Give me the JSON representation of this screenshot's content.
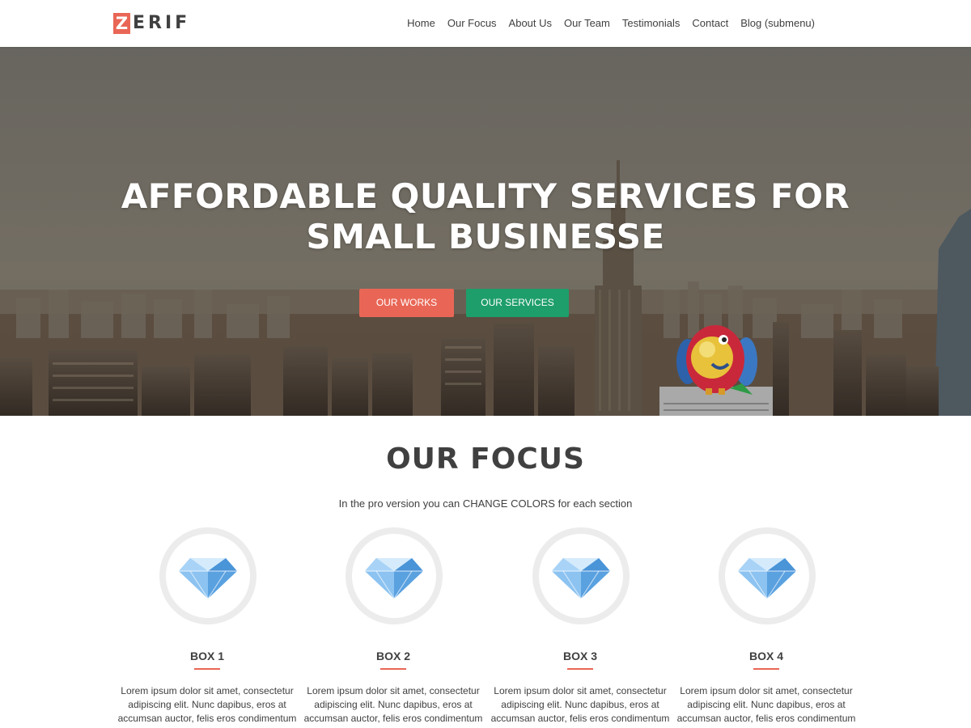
{
  "header": {
    "logo_letter": "Z",
    "logo_rest": "ERIF",
    "nav": [
      "Home",
      "Our Focus",
      "About Us",
      "Our Team",
      "Testimonials",
      "Contact",
      "Blog (submenu)"
    ]
  },
  "hero": {
    "title_line1": "AFFORDABLE QUALITY SERVICES FOR",
    "title_line2": "SMALL BUSINESSE",
    "btn_works": "OUR WORKS",
    "btn_services": "OUR SERVICES"
  },
  "focus": {
    "title": "OUR FOCUS",
    "subtitle": "In the pro version you can CHANGE COLORS for each section",
    "boxes": [
      {
        "title": "BOX 1",
        "icon": "diamond-icon",
        "text": "Lorem ipsum dolor sit amet, consectetur adipiscing elit. Nunc dapibus, eros at accumsan auctor, felis eros condimentum"
      },
      {
        "title": "BOX 2",
        "icon": "diamond-icon",
        "text": "Lorem ipsum dolor sit amet, consectetur adipiscing elit. Nunc dapibus, eros at accumsan auctor, felis eros condimentum"
      },
      {
        "title": "BOX 3",
        "icon": "diamond-icon",
        "text": "Lorem ipsum dolor sit amet, consectetur adipiscing elit. Nunc dapibus, eros at accumsan auctor, felis eros condimentum"
      },
      {
        "title": "BOX 4",
        "icon": "diamond-icon",
        "text": "Lorem ipsum dolor sit amet, consectetur adipiscing elit. Nunc dapibus, eros at accumsan auctor, felis eros condimentum"
      }
    ]
  },
  "colors": {
    "accent_red": "#e96656",
    "accent_green": "#1e9e6b",
    "text": "#404040"
  }
}
